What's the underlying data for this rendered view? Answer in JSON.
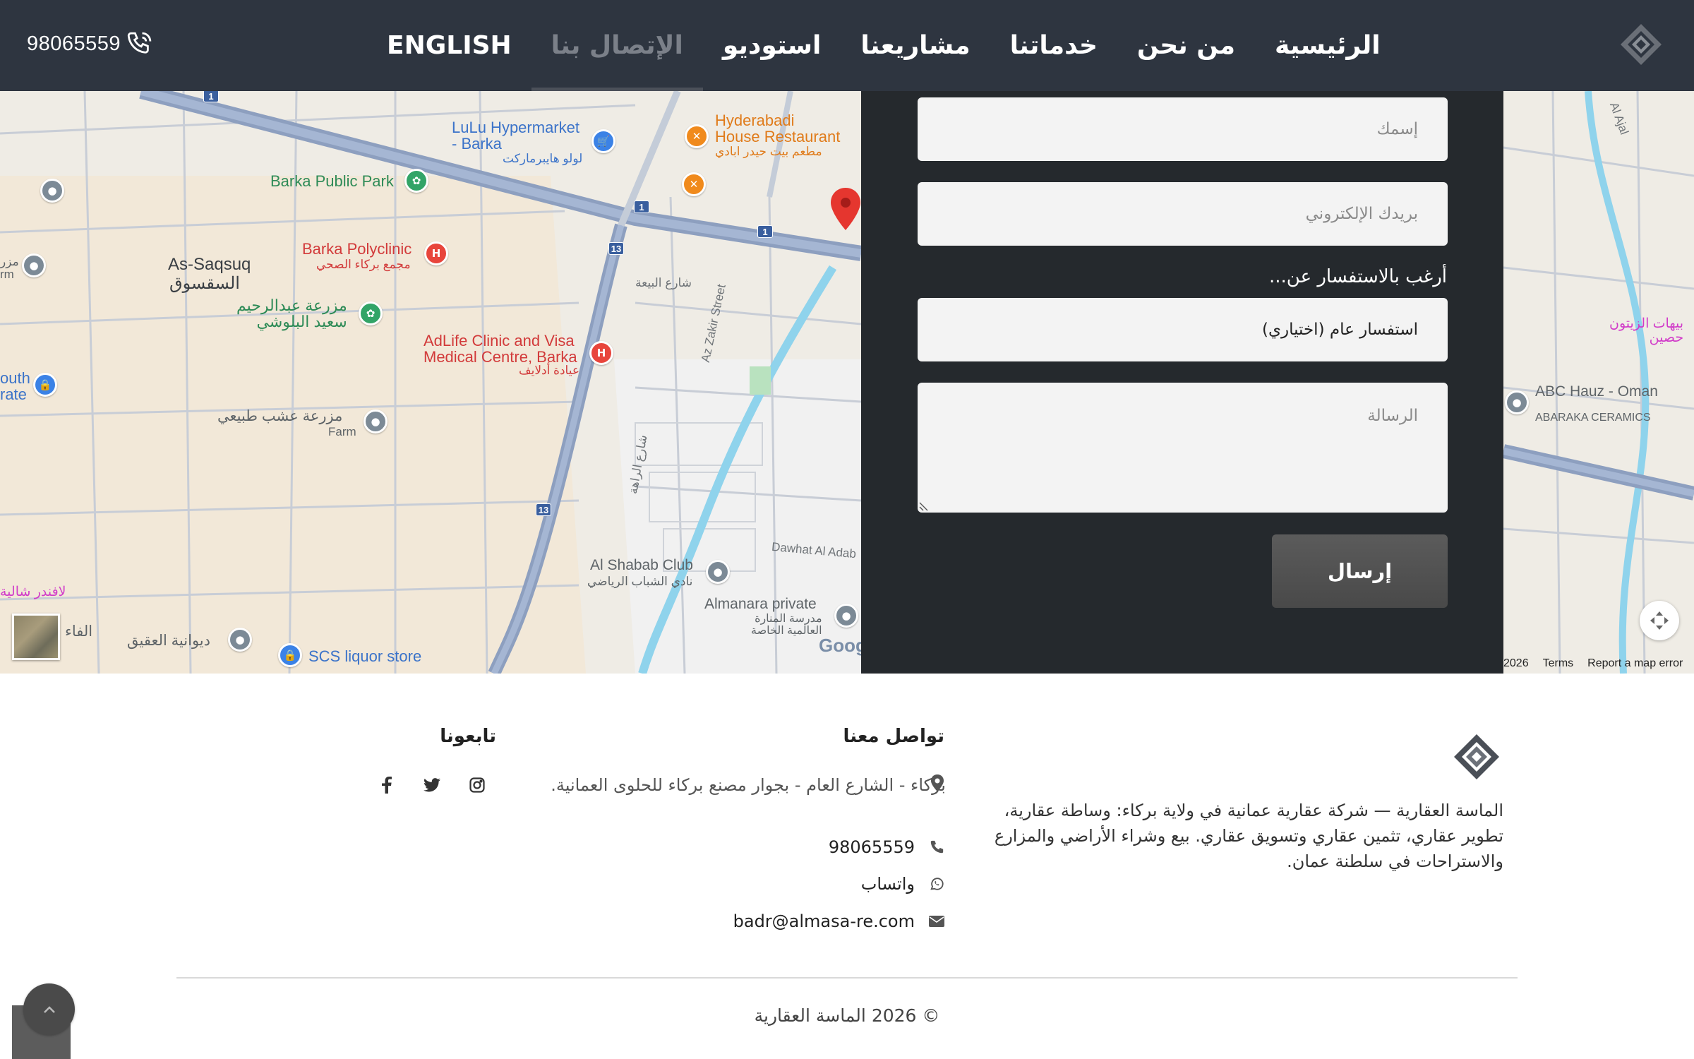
{
  "nav": {
    "phone": "98065559",
    "items": [
      {
        "label": "ENGLISH",
        "active": false
      },
      {
        "label": "الإتصال بنا",
        "active": true
      },
      {
        "label": "استوديو",
        "active": false
      },
      {
        "label": "مشاريعنا",
        "active": false
      },
      {
        "label": "خدماتنا",
        "active": false
      },
      {
        "label": "من نحن",
        "active": false
      },
      {
        "label": "الرئيسية",
        "active": false
      }
    ]
  },
  "map": {
    "labels": {
      "lulu": "LuLu Hypermarket\n- Barka",
      "lulu_ar": "لولو هايبرماركت",
      "hyderabadi": "Hyderabadi\nHouse Restaurant",
      "hyderabadi_ar": "مطعم بيت حيدر ابادي",
      "barka_park": "Barka Public Park",
      "as_saqsuq": "As-Saqsuq",
      "as_saqsuq_ar": "السقسوق",
      "polyclinic": "Barka Polyclinic",
      "polyclinic_ar": "مجمع بركاء الصحي",
      "farm_ar": "مزرعة عبدالرحيم\nسعيد البلوشي",
      "adlife": "AdLife Clinic and Visa\nMedical Centre, Barka",
      "adlife_ar": "عيادة أدلايف",
      "shari_al_baya": "شارع البيعة",
      "zakir_street": "Az Zakir Street",
      "herb_farm_ar": "مزرعة عشب طبيعي",
      "herb_farm": "Farm",
      "south_rate": "outh\nrate",
      "farm_left": "مزر\nrm",
      "shari_al_rahah": "شارع الراهة",
      "dawhat": "Dawhat Al Adab",
      "shabab_club": "Al Shabab Club",
      "shabab_club_ar": "نادي الشباب الرياضي",
      "almanara": "Almanara private",
      "almanara_ar": "مدرسة المنارة\nالعالمية الخاصة",
      "diwan_al_aqiq": "ديوانية العقيق",
      "al_faa": "الفاء",
      "scs_liquor": "SCS liquor store",
      "pink_left": "لافندر شالية",
      "pink_right": "بيهات الزيتون\nحصين",
      "abc_hauz": "ABC Hauz - Oman",
      "abc_hauz_sub": "ABARAKA CERAMICS",
      "ajal": "Al Ajal"
    },
    "routes": [
      "1",
      "1",
      "1",
      "13",
      "13"
    ],
    "google": "Goog",
    "footer": {
      "year": "2026",
      "terms": "Terms",
      "report": "Report a map error"
    }
  },
  "form": {
    "name_placeholder": "إسمك",
    "email_placeholder": "بريدك الإلكتروني",
    "inquiry_label": "أرغب بالاستفسار عن...",
    "inquiry_value": "استفسار عام (اختياري)",
    "message_placeholder": "الرسالة",
    "submit": "إرسال"
  },
  "footer": {
    "about_text": "الماسة العقارية — شركة عقارية عمانية في ولاية بركاء: وساطة عقارية، تطوير عقاري، تثمين عقاري وتسويق عقاري. بيع وشراء الأراضي والمزارع والاستراحات في سلطنة عمان.",
    "contact_title": "تواصل معنا",
    "address": "بركاء - الشارع العام - بجوار مصنع بركاء للحلوى العمانية.",
    "phone": "98065559",
    "whatsapp": "واتساب",
    "email": "badr@almasa-re.com",
    "follow_title": "تابعونا",
    "copyright": "© 2026 الماسة العقارية"
  },
  "colors": {
    "nav_bg": "#2e3540",
    "form_bg": "#25292d",
    "accent": "#4b5059"
  }
}
